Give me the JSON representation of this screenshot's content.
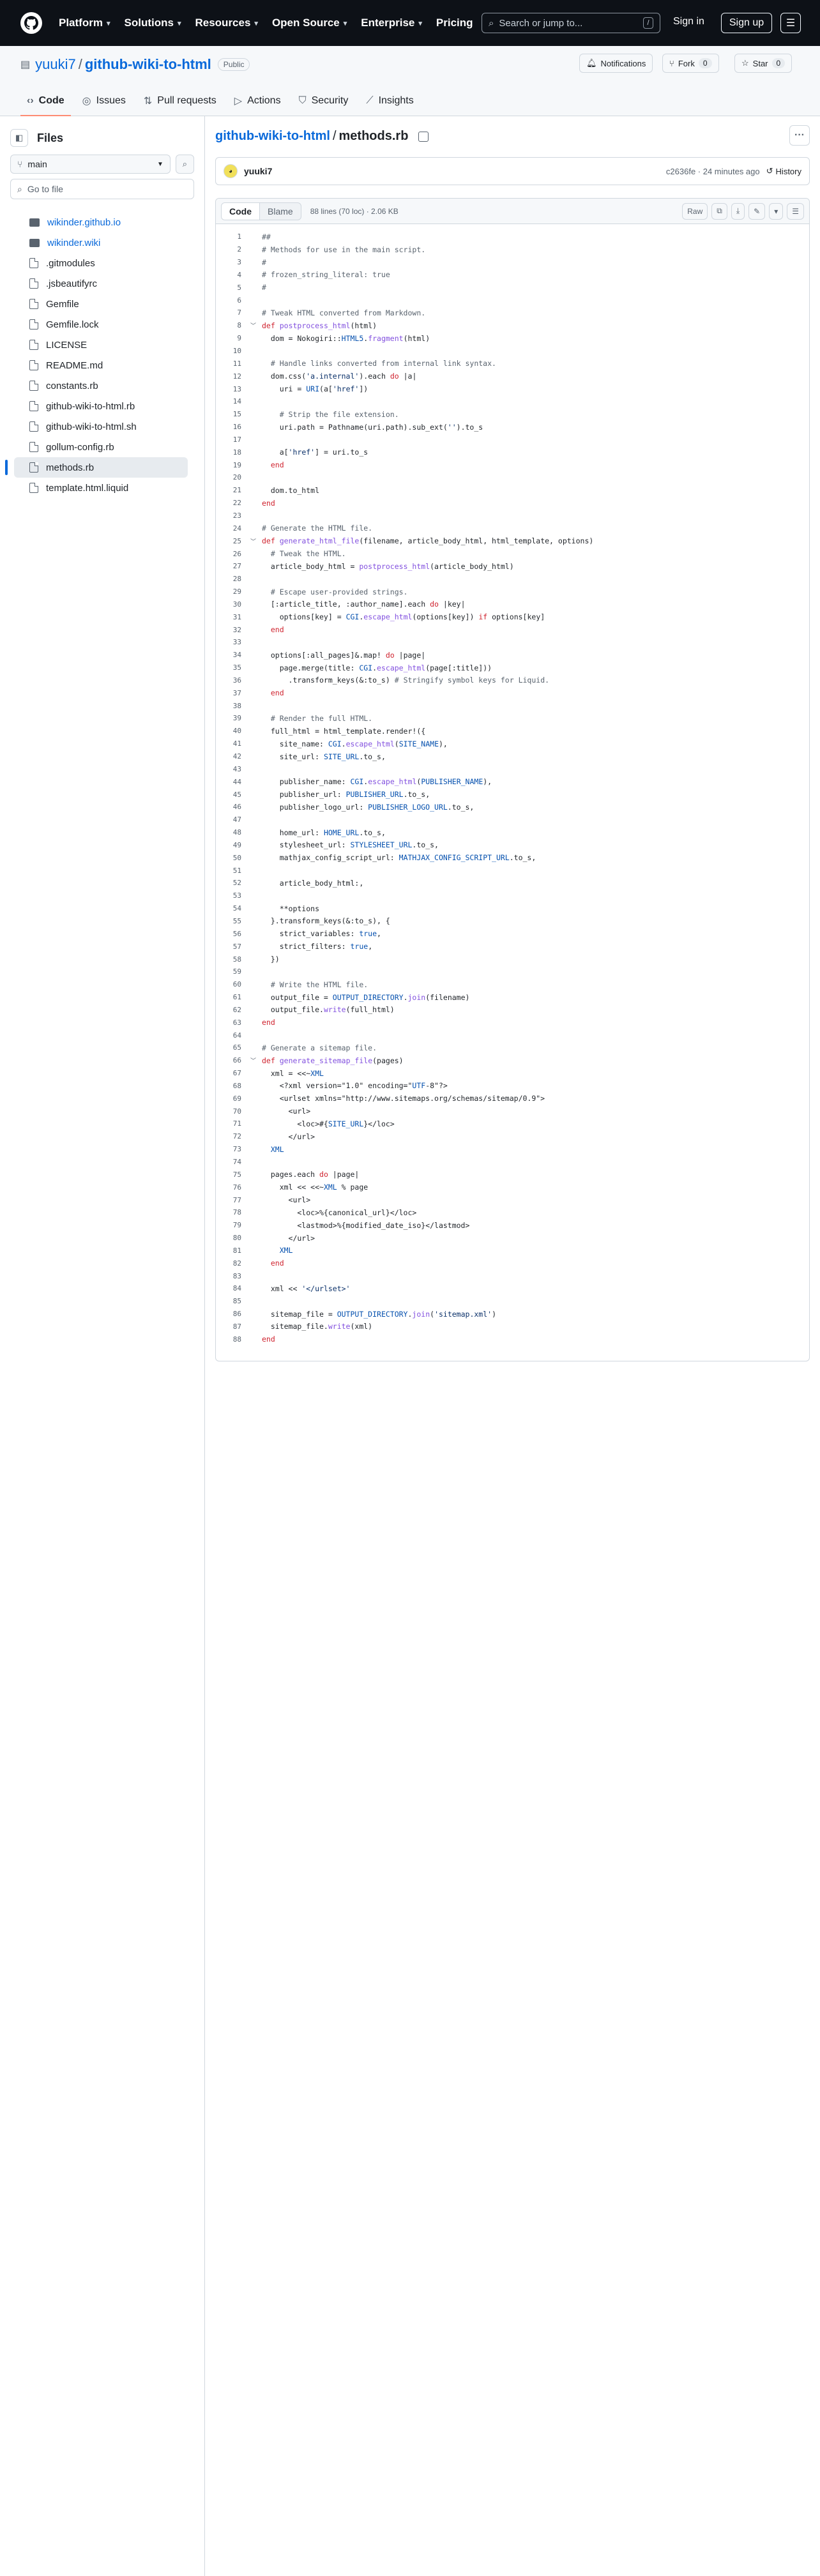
{
  "header": {
    "nav": [
      "Platform",
      "Solutions",
      "Resources",
      "Open Source",
      "Enterprise",
      "Pricing"
    ],
    "search_placeholder": "Search or jump to...",
    "search_key": "/",
    "sign_in": "Sign in",
    "sign_up": "Sign up"
  },
  "repo": {
    "owner": "yuuki7",
    "name": "github-wiki-to-html",
    "visibility": "Public",
    "notifications": "Notifications",
    "fork_label": "Fork",
    "fork_count": "0",
    "star_label": "Star",
    "star_count": "0"
  },
  "tabs": [
    {
      "label": "Code",
      "icon": "code-icon"
    },
    {
      "label": "Issues",
      "icon": "issue-icon"
    },
    {
      "label": "Pull requests",
      "icon": "pr-icon"
    },
    {
      "label": "Actions",
      "icon": "actions-icon"
    },
    {
      "label": "Security",
      "icon": "shield-icon"
    },
    {
      "label": "Insights",
      "icon": "graph-icon"
    }
  ],
  "sidebar": {
    "title": "Files",
    "branch": "main",
    "goto_placeholder": "Go to file",
    "items": [
      {
        "label": "wikinder.github.io",
        "type": "submodule"
      },
      {
        "label": "wikinder.wiki",
        "type": "submodule"
      },
      {
        "label": ".gitmodules",
        "type": "file"
      },
      {
        "label": ".jsbeautifyrc",
        "type": "file"
      },
      {
        "label": "Gemfile",
        "type": "file"
      },
      {
        "label": "Gemfile.lock",
        "type": "file"
      },
      {
        "label": "LICENSE",
        "type": "file"
      },
      {
        "label": "README.md",
        "type": "file"
      },
      {
        "label": "constants.rb",
        "type": "file"
      },
      {
        "label": "github-wiki-to-html.rb",
        "type": "file"
      },
      {
        "label": "github-wiki-to-html.sh",
        "type": "file"
      },
      {
        "label": "gollum-config.rb",
        "type": "file"
      },
      {
        "label": "methods.rb",
        "type": "file",
        "selected": true
      },
      {
        "label": "template.html.liquid",
        "type": "file"
      }
    ]
  },
  "breadcrumb": {
    "repo": "github-wiki-to-html",
    "sep": "/",
    "file": "methods.rb"
  },
  "commit": {
    "author": "yuuki7",
    "sha": "c2636fe",
    "time": "24 minutes ago",
    "history": "History"
  },
  "file": {
    "code_tab": "Code",
    "blame_tab": "Blame",
    "stats": "88 lines (70 loc) · 2.06 KB",
    "raw": "Raw"
  },
  "code_lines": [
    "##",
    "# Methods for use in the main script.",
    "#",
    "# frozen_string_literal: true",
    "#",
    "",
    "# Tweak HTML converted from Markdown.",
    "def postprocess_html(html)",
    "  dom = Nokogiri::HTML5.fragment(html)",
    "",
    "  # Handle links converted from internal link syntax.",
    "  dom.css('a.internal').each do |a|",
    "    uri = URI(a['href'])",
    "",
    "    # Strip the file extension.",
    "    uri.path = Pathname(uri.path).sub_ext('').to_s",
    "",
    "    a['href'] = uri.to_s",
    "  end",
    "",
    "  dom.to_html",
    "end",
    "",
    "# Generate the HTML file.",
    "def generate_html_file(filename, article_body_html, html_template, options)",
    "  # Tweak the HTML.",
    "  article_body_html = postprocess_html(article_body_html)",
    "",
    "  # Escape user-provided strings.",
    "  [:article_title, :author_name].each do |key|",
    "    options[key] = CGI.escape_html(options[key]) if options[key]",
    "  end",
    "",
    "  options[:all_pages]&.map! do |page|",
    "    page.merge(title: CGI.escape_html(page[:title]))",
    "      .transform_keys(&:to_s) # Stringify symbol keys for Liquid.",
    "  end",
    "",
    "  # Render the full HTML.",
    "  full_html = html_template.render!({",
    "    site_name: CGI.escape_html(SITE_NAME),",
    "    site_url: SITE_URL.to_s,",
    "",
    "    publisher_name: CGI.escape_html(PUBLISHER_NAME),",
    "    publisher_url: PUBLISHER_URL.to_s,",
    "    publisher_logo_url: PUBLISHER_LOGO_URL.to_s,",
    "",
    "    home_url: HOME_URL.to_s,",
    "    stylesheet_url: STYLESHEET_URL.to_s,",
    "    mathjax_config_script_url: MATHJAX_CONFIG_SCRIPT_URL.to_s,",
    "",
    "    article_body_html:,",
    "",
    "    **options",
    "  }.transform_keys(&:to_s), {",
    "    strict_variables: true,",
    "    strict_filters: true,",
    "  })",
    "",
    "  # Write the HTML file.",
    "  output_file = OUTPUT_DIRECTORY.join(filename)",
    "  output_file.write(full_html)",
    "end",
    "",
    "# Generate a sitemap file.",
    "def generate_sitemap_file(pages)",
    "  xml = <<~XML",
    "    <?xml version=\"1.0\" encoding=\"UTF-8\"?>",
    "    <urlset xmlns=\"http://www.sitemaps.org/schemas/sitemap/0.9\">",
    "      <url>",
    "        <loc>#{SITE_URL}</loc>",
    "      </url>",
    "  XML",
    "",
    "  pages.each do |page|",
    "    xml << <<~XML % page",
    "      <url>",
    "        <loc>%{canonical_url}</loc>",
    "        <lastmod>%{modified_date_iso}</lastmod>",
    "      </url>",
    "    XML",
    "  end",
    "",
    "  xml << '</urlset>'",
    "",
    "  sitemap_file = OUTPUT_DIRECTORY.join('sitemap.xml')",
    "  sitemap_file.write(xml)",
    "end"
  ],
  "folds": [
    8,
    25,
    66
  ],
  "colors": {
    "keyword": "#cf222e",
    "comment": "#59636e",
    "function": "#8250df",
    "string": "#0a3069",
    "constant": "#0550ae",
    "link": "#0969da",
    "active_tab": "#fd8c73"
  }
}
